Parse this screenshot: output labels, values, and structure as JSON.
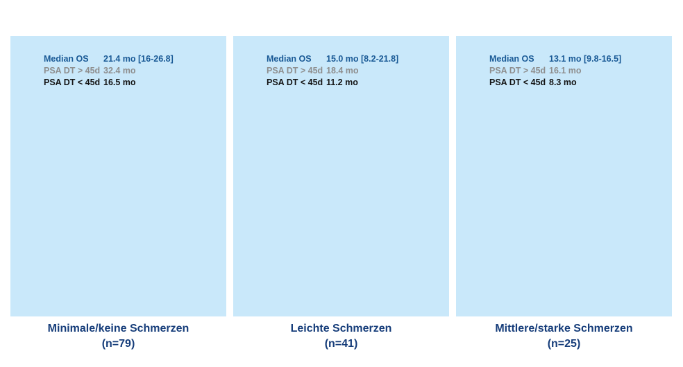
{
  "chart_data": {
    "type": "table",
    "panels": [
      {
        "title": "Minimale/keine Schmerzen",
        "n": "(n=79)",
        "rows": [
          {
            "label": "Median OS",
            "value": "21.4 mo [16-26.8]"
          },
          {
            "label": "PSA DT > 45d",
            "value": "32.4 mo"
          },
          {
            "label": "PSA DT < 45d",
            "value": "16.5 mo"
          }
        ]
      },
      {
        "title": "Leichte Schmerzen",
        "n": "(n=41)",
        "rows": [
          {
            "label": "Median OS",
            "value": "15.0 mo [8.2-21.8]"
          },
          {
            "label": "PSA DT > 45d",
            "value": "18.4 mo"
          },
          {
            "label": "PSA DT < 45d",
            "value": "11.2 mo"
          }
        ]
      },
      {
        "title": "Mittlere/starke Schmerzen",
        "n": "(n=25)",
        "rows": [
          {
            "label": "Median OS",
            "value": "13.1 mo [9.8-16.5]"
          },
          {
            "label": "PSA DT > 45d",
            "value": "16.1 mo"
          },
          {
            "label": "PSA DT < 45d",
            "value": "8.3 mo"
          }
        ]
      }
    ],
    "colors": {
      "panel_background": "#c9e8fa",
      "median_os": "#1a5a96",
      "psa_dt_gt_45d": "#8e8e8e",
      "psa_dt_lt_45d": "#141414",
      "caption": "#163d7a"
    }
  }
}
